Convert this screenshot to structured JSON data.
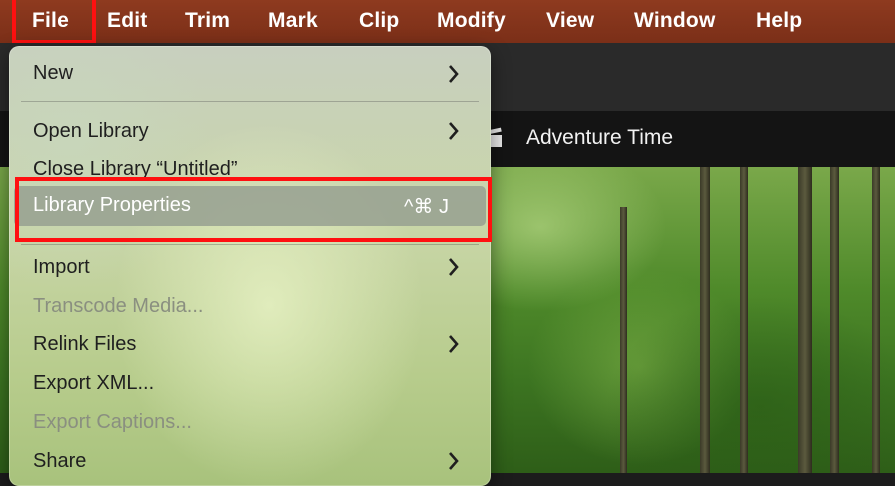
{
  "menubar": {
    "items": [
      "File",
      "Edit",
      "Trim",
      "Mark",
      "Clip",
      "Modify",
      "View",
      "Window",
      "Help"
    ]
  },
  "project": {
    "title": "Adventure Time"
  },
  "file_menu": {
    "new": "New",
    "open_library": "Open Library",
    "close_library": "Close Library “Untitled”",
    "library_properties": "Library Properties",
    "library_properties_shortcut": "^⌘ J",
    "import": "Import",
    "transcode_media": "Transcode Media...",
    "relink_files": "Relink Files",
    "export_xml": "Export XML...",
    "export_captions": "Export Captions...",
    "share": "Share"
  },
  "colors": {
    "menubar_bg": "#8e3a1f",
    "highlight_box": "#ff1010"
  },
  "icons": {
    "submenu": "chevron-right-icon",
    "project": "clapperboard-icon"
  }
}
